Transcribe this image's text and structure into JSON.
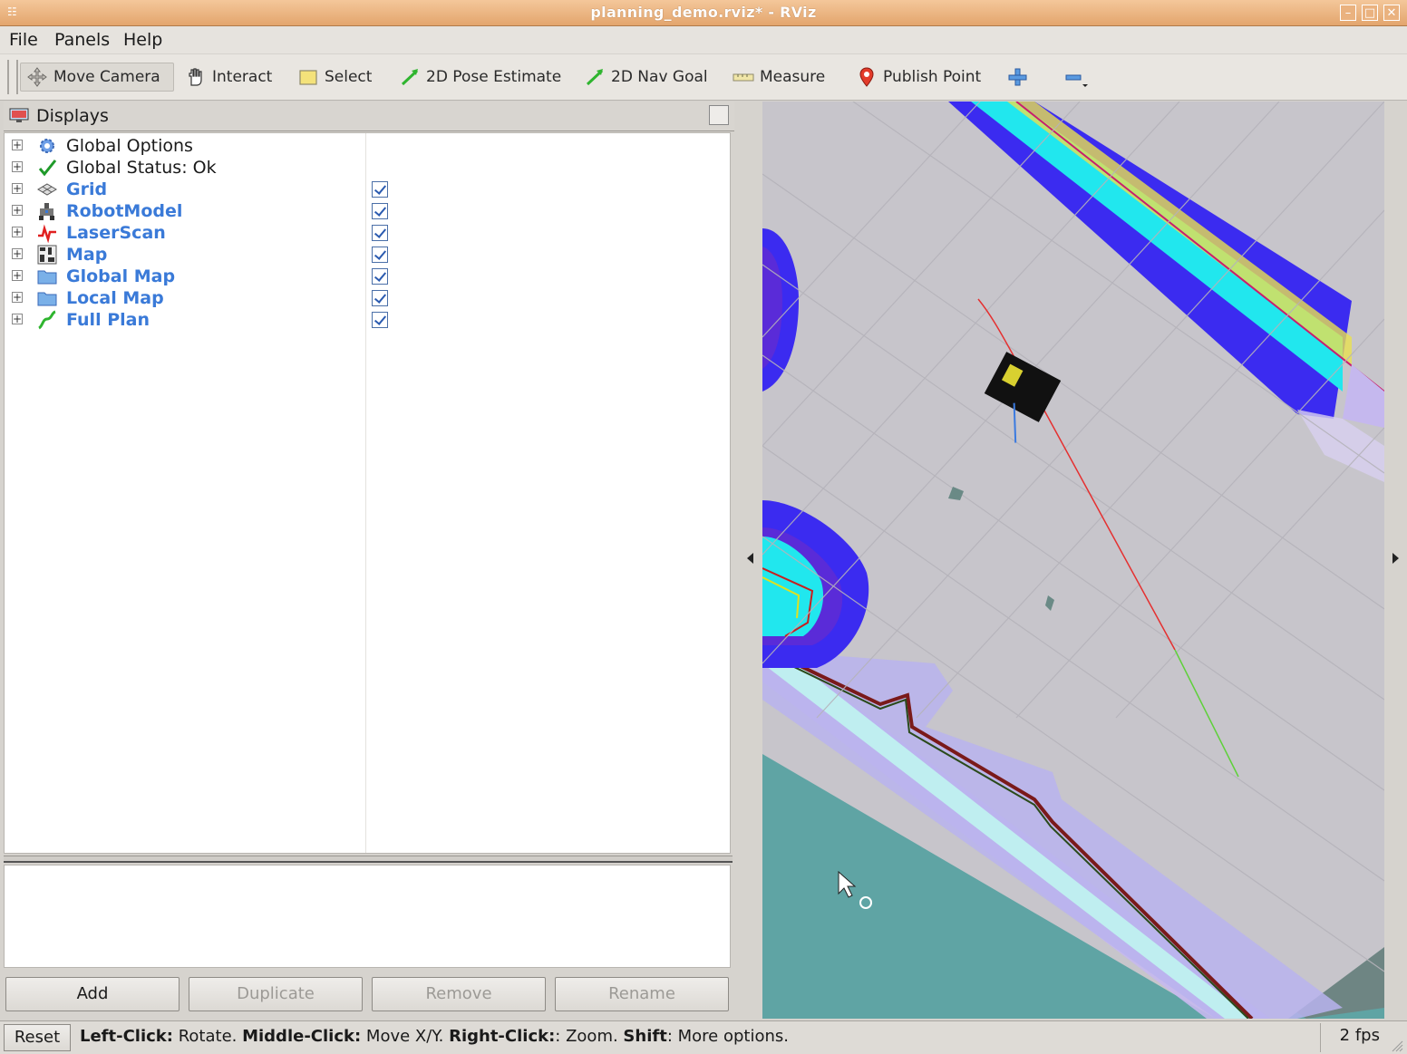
{
  "window": {
    "title": "planning_demo.rviz* - RViz",
    "min": "–",
    "max": "□",
    "close": "✕"
  },
  "menu": [
    "File",
    "Panels",
    "Help"
  ],
  "toolbar": {
    "tools": [
      "Move Camera",
      "Interact",
      "Select",
      "2D Pose Estimate",
      "2D Nav Goal",
      "Measure",
      "Publish Point"
    ],
    "active": "Move Camera",
    "zoom_in": "+",
    "zoom_out": "−"
  },
  "displays_panel": {
    "title": "Displays",
    "items": [
      {
        "label": "Global Options",
        "icon": "gear-icon",
        "enabled": false,
        "checkbox": false
      },
      {
        "label": "Global Status: Ok",
        "icon": "checkmark-icon",
        "enabled": false,
        "checkbox": false
      },
      {
        "label": "Grid",
        "icon": "grid-icon",
        "enabled": true,
        "checkbox": true
      },
      {
        "label": "RobotModel",
        "icon": "robot-icon",
        "enabled": true,
        "checkbox": true
      },
      {
        "label": "LaserScan",
        "icon": "laser-icon",
        "enabled": true,
        "checkbox": true
      },
      {
        "label": "Map",
        "icon": "map-icon",
        "enabled": true,
        "checkbox": true
      },
      {
        "label": "Global Map",
        "icon": "folder-icon",
        "enabled": true,
        "checkbox": true
      },
      {
        "label": "Local Map",
        "icon": "folder-icon",
        "enabled": true,
        "checkbox": true
      },
      {
        "label": "Full Plan",
        "icon": "path-icon",
        "enabled": true,
        "checkbox": true
      }
    ]
  },
  "buttons": {
    "add": "Add",
    "duplicate": "Duplicate",
    "remove": "Remove",
    "rename": "Rename"
  },
  "status": {
    "reset": "Reset",
    "hint_parts": [
      {
        "bold": "Left-Click:",
        "text": " Rotate. "
      },
      {
        "bold": "Middle-Click:",
        "text": " Move X/Y. "
      },
      {
        "bold": "Right-Click:",
        "text": ": Zoom. "
      },
      {
        "bold": "Shift",
        "text": ": More options."
      }
    ],
    "fps": "2 fps"
  },
  "colors": {
    "titlebar": "#e3a56d",
    "enabled_display": "#3a7ad8",
    "map_free": "#c7c5cb",
    "map_unknown": "#6e8583",
    "costmap_inflation": "#3b2bf0",
    "costmap_cyan": "#21e7ee",
    "plan_red": "#e53030",
    "plan_green": "#5fd13a"
  }
}
